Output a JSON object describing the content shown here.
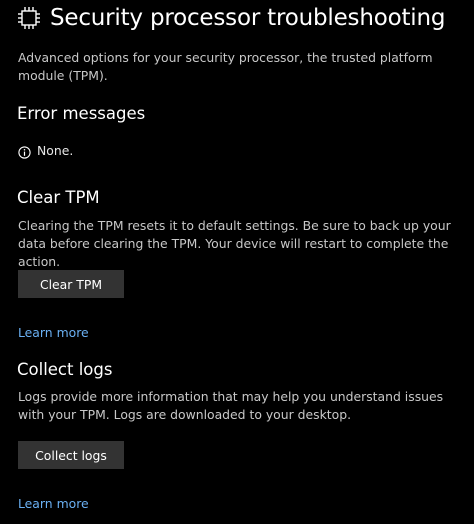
{
  "header": {
    "title": "Security processor troubleshooting",
    "icon": "chip-icon"
  },
  "intro": {
    "description": "Advanced options for your security processor, the trusted platform module (TPM)."
  },
  "error_messages": {
    "heading": "Error messages",
    "status_icon": "info-icon",
    "status_text": "None."
  },
  "clear_tpm": {
    "heading": "Clear TPM",
    "description": "Clearing the TPM resets it to default settings. Be sure to back up your data before clearing the TPM. Your device will restart to complete the action.",
    "button_label": "Clear TPM",
    "link_label": "Learn more"
  },
  "collect_logs": {
    "heading": "Collect logs",
    "description": "Logs provide more information that may help you understand issues with your TPM.  Logs are downloaded to your desktop.",
    "button_label": "Collect logs",
    "link_label": "Learn more"
  },
  "colors": {
    "background": "#000000",
    "text": "#ffffff",
    "secondary_text": "#c8c8c8",
    "button_bg": "#333333",
    "link": "#6ab0f3"
  }
}
